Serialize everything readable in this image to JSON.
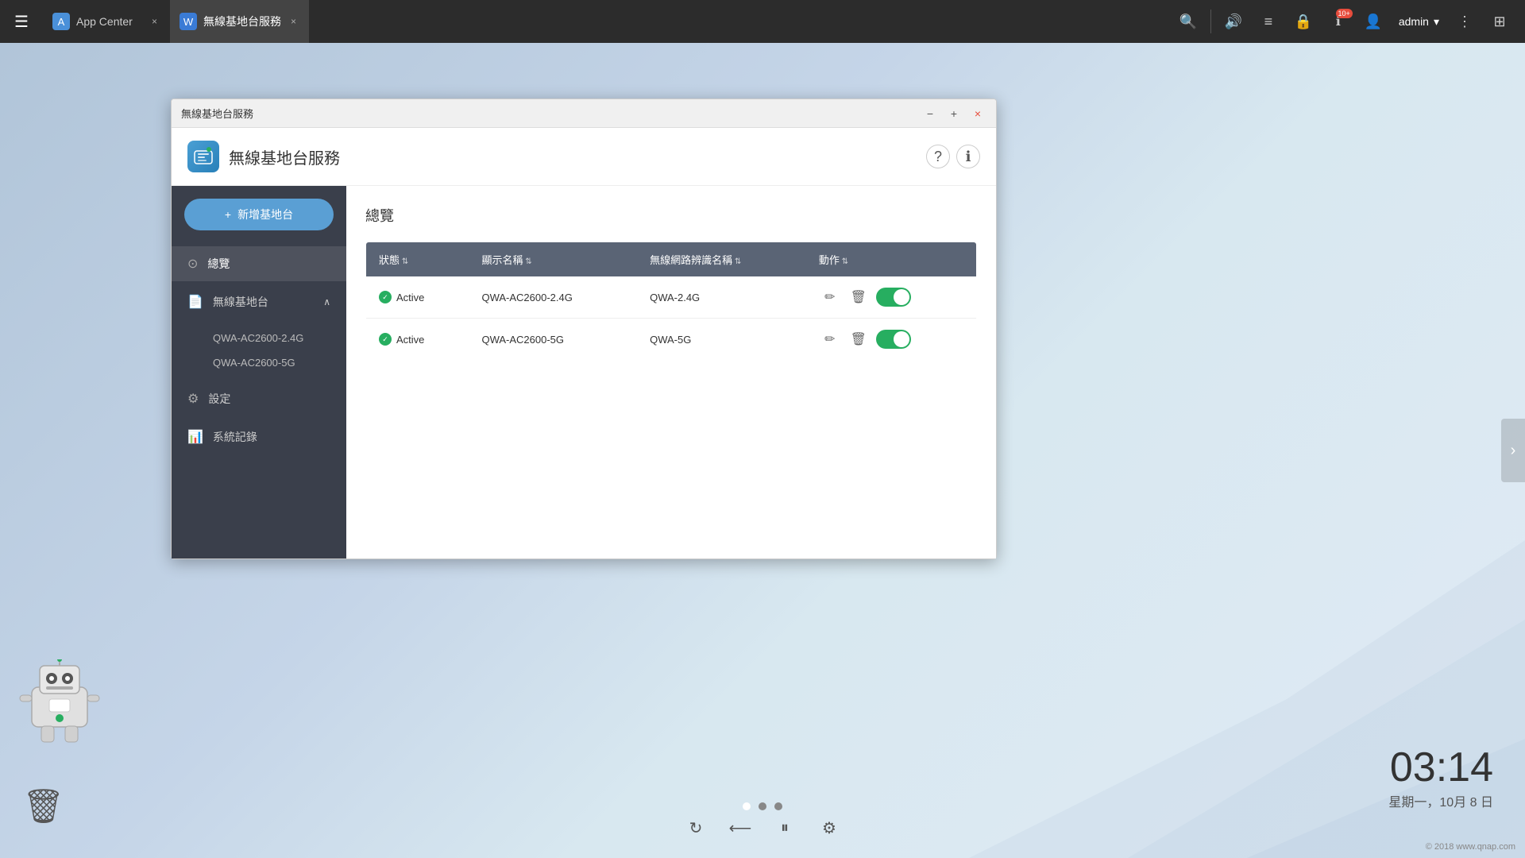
{
  "taskbar": {
    "menu_icon": "☰",
    "tabs": [
      {
        "id": "app-center",
        "label": "App Center",
        "icon": "⬡",
        "active": false
      },
      {
        "id": "wireless",
        "label": "無線基地台服務",
        "icon": "📡",
        "active": true
      }
    ],
    "icons": {
      "search": "🔍",
      "volume": "🔊",
      "stack": "📋",
      "lock": "🔒",
      "notification": "ℹ",
      "notification_badge": "10+",
      "user": "👤",
      "admin_label": "admin",
      "more": "⋮",
      "qnap": "⊞"
    }
  },
  "window": {
    "title": "無線基地台服務",
    "app_title": "無線基地台服務",
    "app_logo": "📡",
    "controls": {
      "minimize": "−",
      "maximize": "+",
      "close": "×"
    },
    "help_icon": "?",
    "info_icon": "ℹ"
  },
  "sidebar": {
    "add_button": "新增基地台",
    "nav_items": [
      {
        "id": "overview",
        "label": "總覽",
        "icon": "⊙",
        "active": true,
        "has_sub": false
      },
      {
        "id": "wireless",
        "label": "無線基地台",
        "icon": "📄",
        "active": false,
        "has_sub": true,
        "sub_items": [
          {
            "id": "qwa-2.4g",
            "label": "QWA-AC2600-2.4G"
          },
          {
            "id": "qwa-5g",
            "label": "QWA-AC2600-5G"
          }
        ]
      },
      {
        "id": "settings",
        "label": "設定",
        "icon": "⚙",
        "active": false,
        "has_sub": false
      },
      {
        "id": "logs",
        "label": "系統記錄",
        "icon": "📊",
        "active": false,
        "has_sub": false
      }
    ]
  },
  "content": {
    "section_title": "總覽",
    "table": {
      "columns": [
        {
          "id": "status",
          "label": "狀態"
        },
        {
          "id": "display_name",
          "label": "顯示名稱"
        },
        {
          "id": "ssid",
          "label": "無線網路辨識名稱"
        },
        {
          "id": "action",
          "label": "動作"
        }
      ],
      "rows": [
        {
          "status": "Active",
          "display_name": "QWA-AC2600-2.4G",
          "ssid": "QWA-2.4G",
          "enabled": true
        },
        {
          "status": "Active",
          "display_name": "QWA-AC2600-5G",
          "ssid": "QWA-5G",
          "enabled": true
        }
      ]
    }
  },
  "desktop": {
    "clock_time": "03:14",
    "clock_date": "星期一，10月 8 日",
    "dots": [
      {
        "active": true
      },
      {
        "active": false
      },
      {
        "active": false
      }
    ]
  }
}
